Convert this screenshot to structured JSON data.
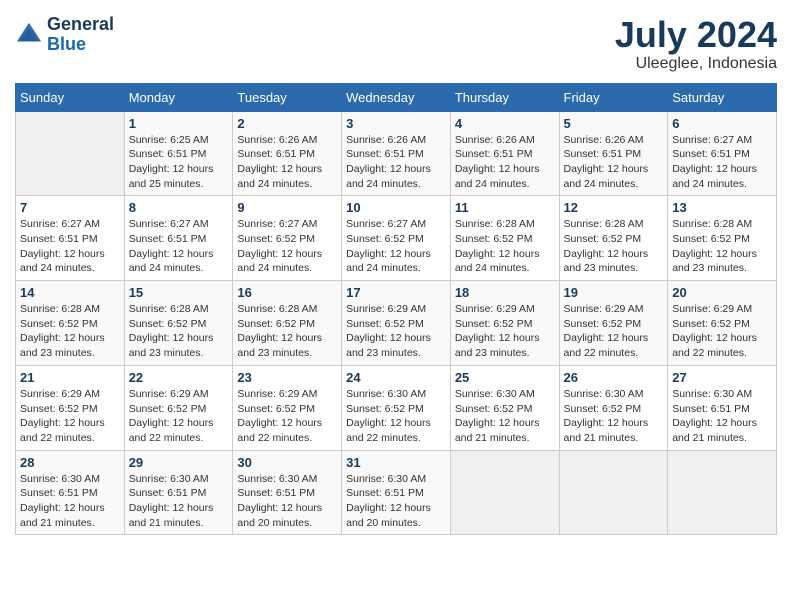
{
  "logo": {
    "line1": "General",
    "line2": "Blue"
  },
  "title": "July 2024",
  "subtitle": "Uleeglee, Indonesia",
  "days_of_week": [
    "Sunday",
    "Monday",
    "Tuesday",
    "Wednesday",
    "Thursday",
    "Friday",
    "Saturday"
  ],
  "weeks": [
    [
      {
        "num": "",
        "info": ""
      },
      {
        "num": "1",
        "info": "Sunrise: 6:25 AM\nSunset: 6:51 PM\nDaylight: 12 hours\nand 25 minutes."
      },
      {
        "num": "2",
        "info": "Sunrise: 6:26 AM\nSunset: 6:51 PM\nDaylight: 12 hours\nand 24 minutes."
      },
      {
        "num": "3",
        "info": "Sunrise: 6:26 AM\nSunset: 6:51 PM\nDaylight: 12 hours\nand 24 minutes."
      },
      {
        "num": "4",
        "info": "Sunrise: 6:26 AM\nSunset: 6:51 PM\nDaylight: 12 hours\nand 24 minutes."
      },
      {
        "num": "5",
        "info": "Sunrise: 6:26 AM\nSunset: 6:51 PM\nDaylight: 12 hours\nand 24 minutes."
      },
      {
        "num": "6",
        "info": "Sunrise: 6:27 AM\nSunset: 6:51 PM\nDaylight: 12 hours\nand 24 minutes."
      }
    ],
    [
      {
        "num": "7",
        "info": "Sunrise: 6:27 AM\nSunset: 6:51 PM\nDaylight: 12 hours\nand 24 minutes."
      },
      {
        "num": "8",
        "info": "Sunrise: 6:27 AM\nSunset: 6:51 PM\nDaylight: 12 hours\nand 24 minutes."
      },
      {
        "num": "9",
        "info": "Sunrise: 6:27 AM\nSunset: 6:52 PM\nDaylight: 12 hours\nand 24 minutes."
      },
      {
        "num": "10",
        "info": "Sunrise: 6:27 AM\nSunset: 6:52 PM\nDaylight: 12 hours\nand 24 minutes."
      },
      {
        "num": "11",
        "info": "Sunrise: 6:28 AM\nSunset: 6:52 PM\nDaylight: 12 hours\nand 24 minutes."
      },
      {
        "num": "12",
        "info": "Sunrise: 6:28 AM\nSunset: 6:52 PM\nDaylight: 12 hours\nand 23 minutes."
      },
      {
        "num": "13",
        "info": "Sunrise: 6:28 AM\nSunset: 6:52 PM\nDaylight: 12 hours\nand 23 minutes."
      }
    ],
    [
      {
        "num": "14",
        "info": "Sunrise: 6:28 AM\nSunset: 6:52 PM\nDaylight: 12 hours\nand 23 minutes."
      },
      {
        "num": "15",
        "info": "Sunrise: 6:28 AM\nSunset: 6:52 PM\nDaylight: 12 hours\nand 23 minutes."
      },
      {
        "num": "16",
        "info": "Sunrise: 6:28 AM\nSunset: 6:52 PM\nDaylight: 12 hours\nand 23 minutes."
      },
      {
        "num": "17",
        "info": "Sunrise: 6:29 AM\nSunset: 6:52 PM\nDaylight: 12 hours\nand 23 minutes."
      },
      {
        "num": "18",
        "info": "Sunrise: 6:29 AM\nSunset: 6:52 PM\nDaylight: 12 hours\nand 23 minutes."
      },
      {
        "num": "19",
        "info": "Sunrise: 6:29 AM\nSunset: 6:52 PM\nDaylight: 12 hours\nand 22 minutes."
      },
      {
        "num": "20",
        "info": "Sunrise: 6:29 AM\nSunset: 6:52 PM\nDaylight: 12 hours\nand 22 minutes."
      }
    ],
    [
      {
        "num": "21",
        "info": "Sunrise: 6:29 AM\nSunset: 6:52 PM\nDaylight: 12 hours\nand 22 minutes."
      },
      {
        "num": "22",
        "info": "Sunrise: 6:29 AM\nSunset: 6:52 PM\nDaylight: 12 hours\nand 22 minutes."
      },
      {
        "num": "23",
        "info": "Sunrise: 6:29 AM\nSunset: 6:52 PM\nDaylight: 12 hours\nand 22 minutes."
      },
      {
        "num": "24",
        "info": "Sunrise: 6:30 AM\nSunset: 6:52 PM\nDaylight: 12 hours\nand 22 minutes."
      },
      {
        "num": "25",
        "info": "Sunrise: 6:30 AM\nSunset: 6:52 PM\nDaylight: 12 hours\nand 21 minutes."
      },
      {
        "num": "26",
        "info": "Sunrise: 6:30 AM\nSunset: 6:52 PM\nDaylight: 12 hours\nand 21 minutes."
      },
      {
        "num": "27",
        "info": "Sunrise: 6:30 AM\nSunset: 6:51 PM\nDaylight: 12 hours\nand 21 minutes."
      }
    ],
    [
      {
        "num": "28",
        "info": "Sunrise: 6:30 AM\nSunset: 6:51 PM\nDaylight: 12 hours\nand 21 minutes."
      },
      {
        "num": "29",
        "info": "Sunrise: 6:30 AM\nSunset: 6:51 PM\nDaylight: 12 hours\nand 21 minutes."
      },
      {
        "num": "30",
        "info": "Sunrise: 6:30 AM\nSunset: 6:51 PM\nDaylight: 12 hours\nand 20 minutes."
      },
      {
        "num": "31",
        "info": "Sunrise: 6:30 AM\nSunset: 6:51 PM\nDaylight: 12 hours\nand 20 minutes."
      },
      {
        "num": "",
        "info": ""
      },
      {
        "num": "",
        "info": ""
      },
      {
        "num": "",
        "info": ""
      }
    ]
  ]
}
